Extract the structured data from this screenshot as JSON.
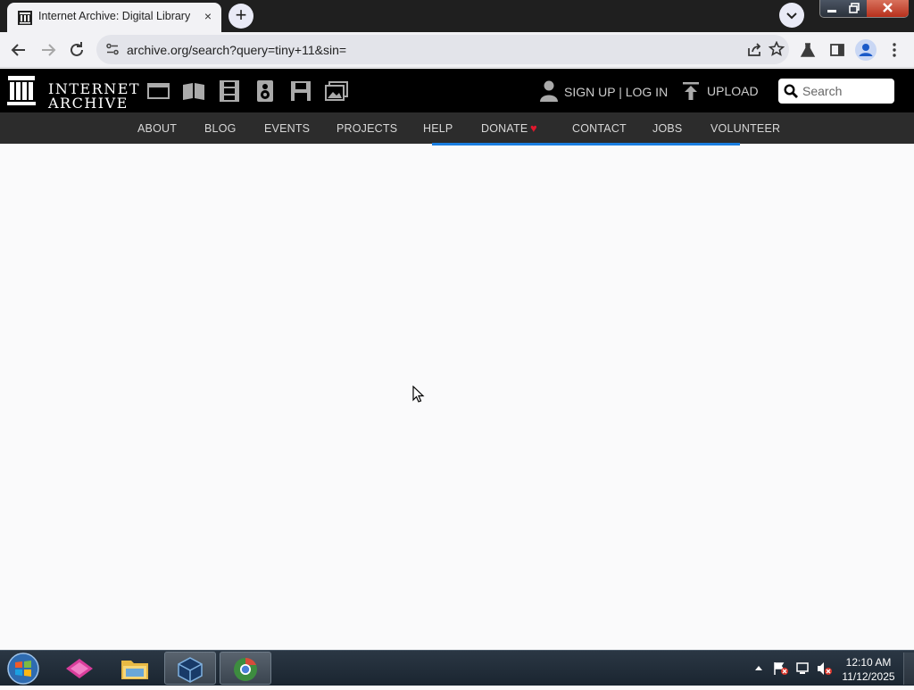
{
  "browser": {
    "tab_title": "Internet Archive: Digital Library",
    "tab_close": "×",
    "new_tab": "+",
    "url": "archive.org/search?query=tiny+11&sin="
  },
  "site": {
    "logo_line1": "INTERNET",
    "logo_line2": "ARCHIVE",
    "media_icons": [
      "web-icon",
      "texts-icon",
      "video-icon",
      "audio-icon",
      "software-icon",
      "images-icon"
    ],
    "account_label": "SIGN UP | LOG IN",
    "upload_label": "UPLOAD",
    "search_placeholder": "Search",
    "nav": [
      {
        "label": "ABOUT"
      },
      {
        "label": "BLOG"
      },
      {
        "label": "EVENTS"
      },
      {
        "label": "PROJECTS"
      },
      {
        "label": "HELP"
      },
      {
        "label": "DONATE"
      },
      {
        "label": "CONTACT"
      },
      {
        "label": "JOBS"
      },
      {
        "label": "VOLUNTEER"
      }
    ],
    "donate_heart": "♥"
  },
  "taskbar": {
    "time": "12:10 AM",
    "date": "11/12/2025"
  },
  "colors": {
    "ia_header": "#000000",
    "ia_nav": "#2c2c2c",
    "progress": "#1a7ee0",
    "donate_heart": "#e0182d"
  }
}
